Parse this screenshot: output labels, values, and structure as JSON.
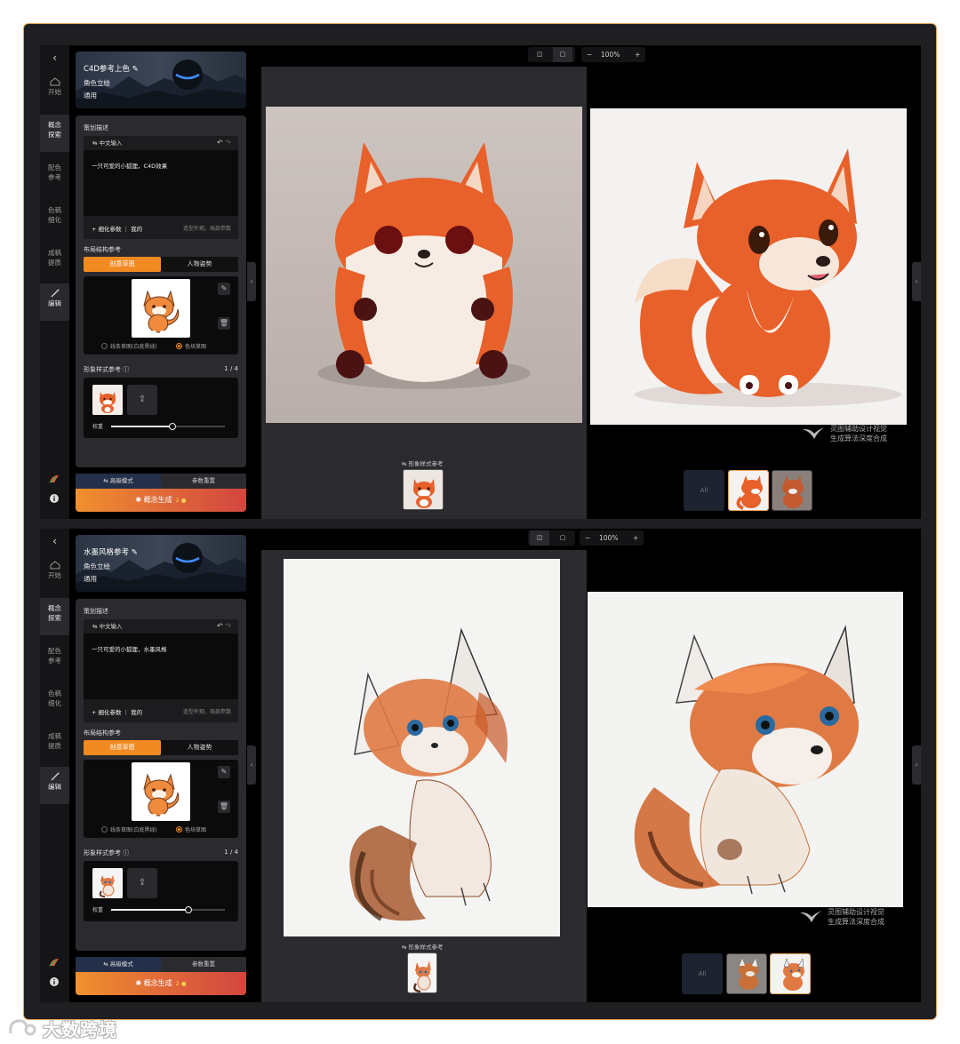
{
  "rail": {
    "items": [
      "开始",
      "概念探索",
      "配色参考",
      "色稿细化",
      "成稿提质",
      "编辑"
    ]
  },
  "panels": [
    {
      "banner": {
        "title": "C4D参考上色",
        "line1": "角色立绘",
        "line2": "通用"
      },
      "section_desc": "策划描述",
      "input_header": "中文输入",
      "prompt": "一只可爱的小狐狸，C4D效果",
      "refine": "细化参数 ｜ 我的",
      "refine_hint": "造型外观，局部参数",
      "layout_ref": "布局结构参考",
      "tab_on": "创意草图",
      "tab_off": "人物姿势",
      "radio_1": "线条草图(白底黑线)",
      "radio_2": "色块草图",
      "style_ref": "形象样式参考",
      "style_count": "1 / 4",
      "weight_label": "权重",
      "weight": 0.54,
      "mode_advanced": "高级模式",
      "mode_reset": "参数重置",
      "generate": "概念生成",
      "cost": "2",
      "zoom": "100%",
      "ref_label": "形象样式参考",
      "wm_line1": "灵图辅助设计视觉",
      "wm_line2": "生成算法深度合成",
      "all_label": "All"
    },
    {
      "banner": {
        "title": "水墨风格参考",
        "line1": "角色立绘",
        "line2": "通用"
      },
      "section_desc": "策划描述",
      "input_header": "中文输入",
      "prompt": "一只可爱的小狐狸，水墨风格",
      "refine": "细化参数 ｜ 我的",
      "refine_hint": "造型外观，局部参数",
      "layout_ref": "布局结构参考",
      "tab_on": "创意草图",
      "tab_off": "人物姿势",
      "radio_1": "线条草图(白底黑线)",
      "radio_2": "色块草图",
      "style_ref": "形象样式参考",
      "style_count": "1 / 4",
      "weight_label": "权重",
      "weight": 0.68,
      "mode_advanced": "高级模式",
      "mode_reset": "参数重置",
      "generate": "概念生成",
      "cost": "2",
      "zoom": "100%",
      "ref_label": "形象样式参考",
      "wm_line1": "灵图辅助设计视觉",
      "wm_line2": "生成算法深度合成",
      "all_label": "All"
    }
  ],
  "brand": "大数跨境",
  "colors": {
    "accent": "#f28a22",
    "frame": "#e9a15a",
    "fox": "#e8602a"
  }
}
